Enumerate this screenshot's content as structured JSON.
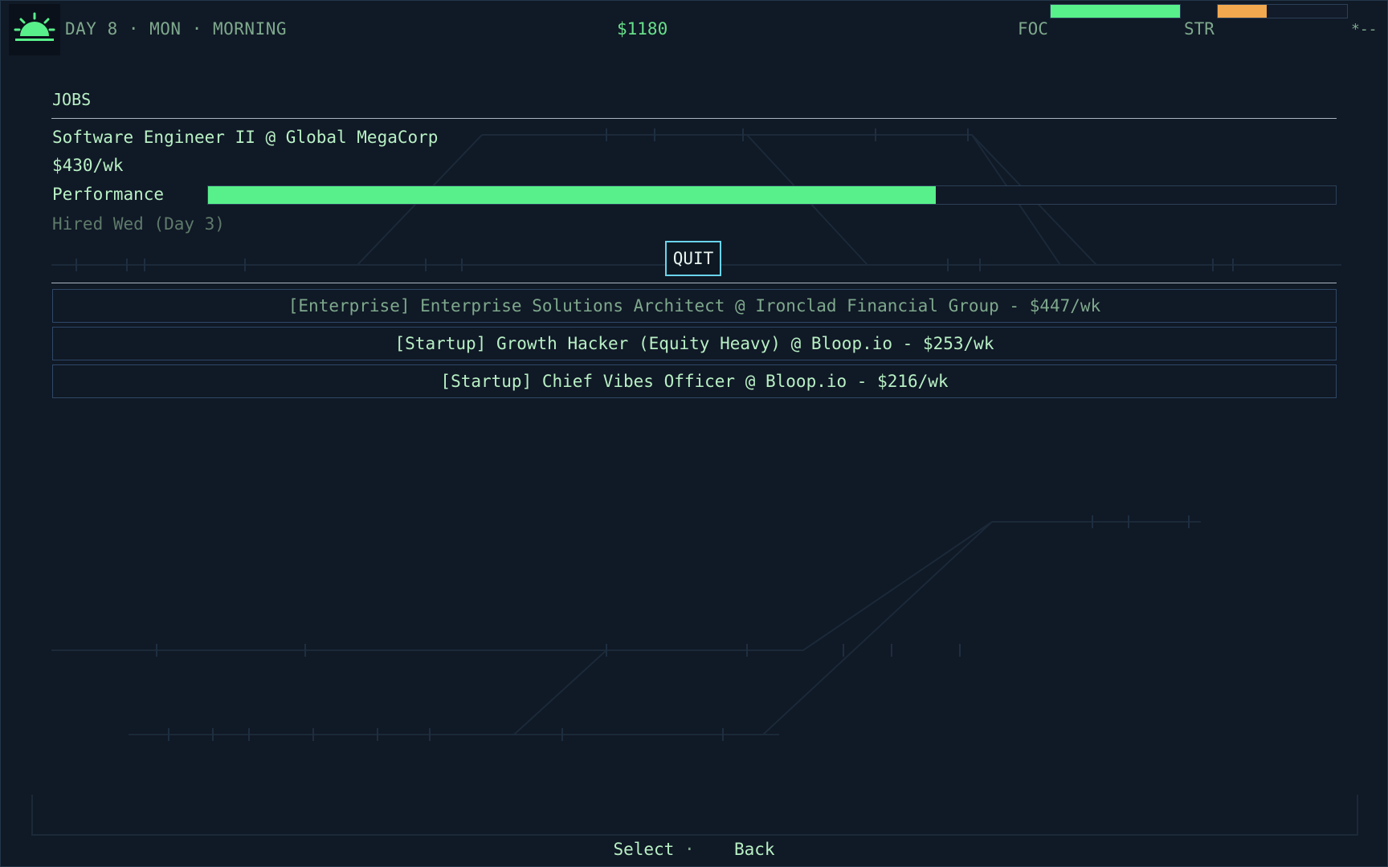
{
  "hud": {
    "sun_icon": "sunrise-icon",
    "day_label": "DAY 8 · MON · MORNING",
    "money": "$1180",
    "stats": [
      {
        "label": "FOC",
        "fill": 1.0,
        "color": "#58f08a"
      },
      {
        "label": "STR",
        "fill": 0.38,
        "color": "#f2a84e"
      }
    ],
    "corner_indicator": "*--"
  },
  "jobs": {
    "heading": "JOBS",
    "current": {
      "title": "Software Engineer II @ Global MegaCorp",
      "wage": "$430/wk",
      "performance_label": "Performance",
      "performance": 0.645,
      "hired_note": "Hired Wed (Day 3)"
    },
    "quit_label": "QUIT",
    "offers": [
      {
        "label": "[Enterprise] Enterprise Solutions Architect @ Ironclad Financial Group - $447/wk",
        "dim": true
      },
      {
        "label": "[Startup] Growth Hacker (Equity Heavy) @ Bloop.io - $253/wk",
        "dim": false
      },
      {
        "label": "[Startup] Chief Vibes Officer @ Bloop.io - $216/wk",
        "dim": false
      }
    ]
  },
  "footer": {
    "select_label": "Select",
    "separator": "·",
    "back_label": "Back"
  },
  "colors": {
    "background": "#101926",
    "accent_green": "#58f08a",
    "accent_orange": "#f2a84e",
    "focus_border": "#6ad4ea"
  }
}
